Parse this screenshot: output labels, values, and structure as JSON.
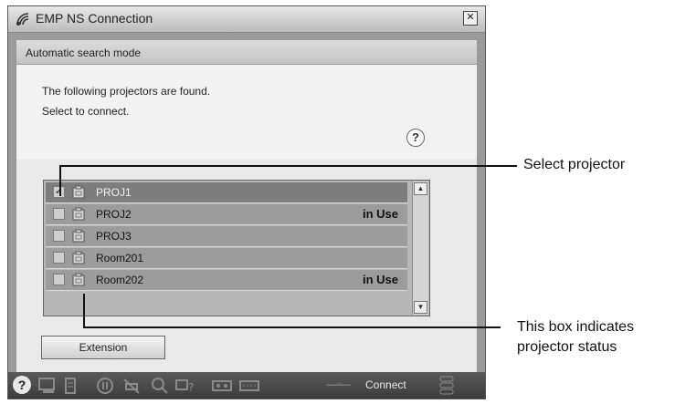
{
  "window": {
    "title": "EMP NS Connection",
    "close_label": "✕"
  },
  "mode_bar": {
    "label": "Automatic search mode"
  },
  "info": {
    "line1": "The following projectors are found.",
    "line2": "Select to connect.",
    "help_label": "?"
  },
  "projectors": [
    {
      "name": "PROJ1",
      "status": "",
      "checked": true,
      "check_mark": "✓"
    },
    {
      "name": "PROJ2",
      "status": "in Use",
      "checked": false,
      "check_mark": ""
    },
    {
      "name": "PROJ3",
      "status": "",
      "checked": false,
      "check_mark": ""
    },
    {
      "name": "Room201",
      "status": "",
      "checked": false,
      "check_mark": ""
    },
    {
      "name": "Room202",
      "status": "in Use",
      "checked": false,
      "check_mark": ""
    }
  ],
  "scroll": {
    "up_label": "▲",
    "down_label": "▼"
  },
  "extension_button": {
    "label": "Extension"
  },
  "toolbar": {
    "help_label": "?",
    "connect_label": "Connect",
    "connect_glyph": "—▫—"
  },
  "callouts": {
    "select_projector": "Select projector",
    "status_line1": "This box indicates",
    "status_line2": "projector status"
  },
  "colors": {
    "list_background": "#9c9c9c",
    "selected_row": "#7d7d7d",
    "toolbar": "#4a4a4a"
  }
}
